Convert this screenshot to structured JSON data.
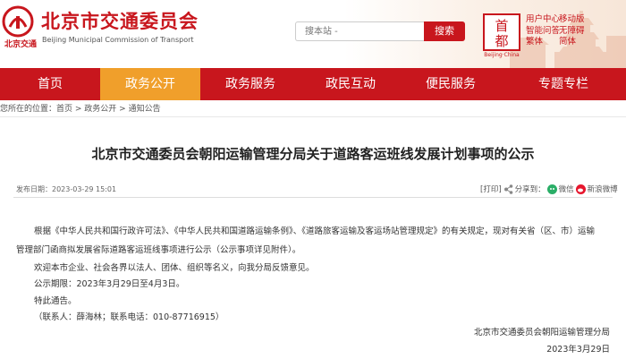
{
  "header": {
    "site_title": "北京市交通委员会",
    "site_title_en": "Beijing Municipal Commission of Transport",
    "logo_caption": "北京交通",
    "search_placeholder": "搜本站 -",
    "search_button": "搜索",
    "emblem_caption": "Beijing·China",
    "links_col1": [
      "用户中心",
      "智能问答",
      "繁体"
    ],
    "links_col2": [
      "移动版",
      "无障碍",
      "简体"
    ]
  },
  "nav": {
    "items": [
      {
        "label": "首页"
      },
      {
        "label": "政务公开"
      },
      {
        "label": "政务服务"
      },
      {
        "label": "政民互动"
      },
      {
        "label": "便民服务"
      },
      {
        "label": "专题专栏"
      }
    ]
  },
  "breadcrumb": {
    "prefix": "您所在的位置：",
    "items": [
      "首页",
      "政务公开",
      "通知公告"
    ],
    "sep": " > "
  },
  "article": {
    "title": "北京市交通委员会朝阳运输管理分局关于道路客运班线发展计划事项的公示",
    "meta_label": "发布日期：",
    "date": "2023-03-29 15:01",
    "print_label": "[打印]",
    "share_label": "分享到：",
    "wechat_label": "微信",
    "weibo_label": "新浪微博",
    "para1_line1": "根据《中华人民共和国行政许可法》、《中华人民共和国道路运输条例》、《道路旅客运输及客运场站管理规定》的有关规定，现对有关省（区、市）运输",
    "para1_line2": "管理部门函商拟发展省际道路客运班线事项进行公示（公示事项详见附件）。",
    "para2": "欢迎本市企业、社会各界以法人、团体、组织等名义，向我分局反馈意见。",
    "para3": "公示期限：2023年3月29日至4月3日。",
    "para4": "特此通告。",
    "para5": "（联系人：薛海林；联系电话：010-87716915）",
    "sign_org": "北京市交通委员会朝阳运输管理分局",
    "sign_date": "2023年3月29日"
  },
  "colors": {
    "brand_red": "#c8161d",
    "nav_active": "#f09f2b"
  }
}
